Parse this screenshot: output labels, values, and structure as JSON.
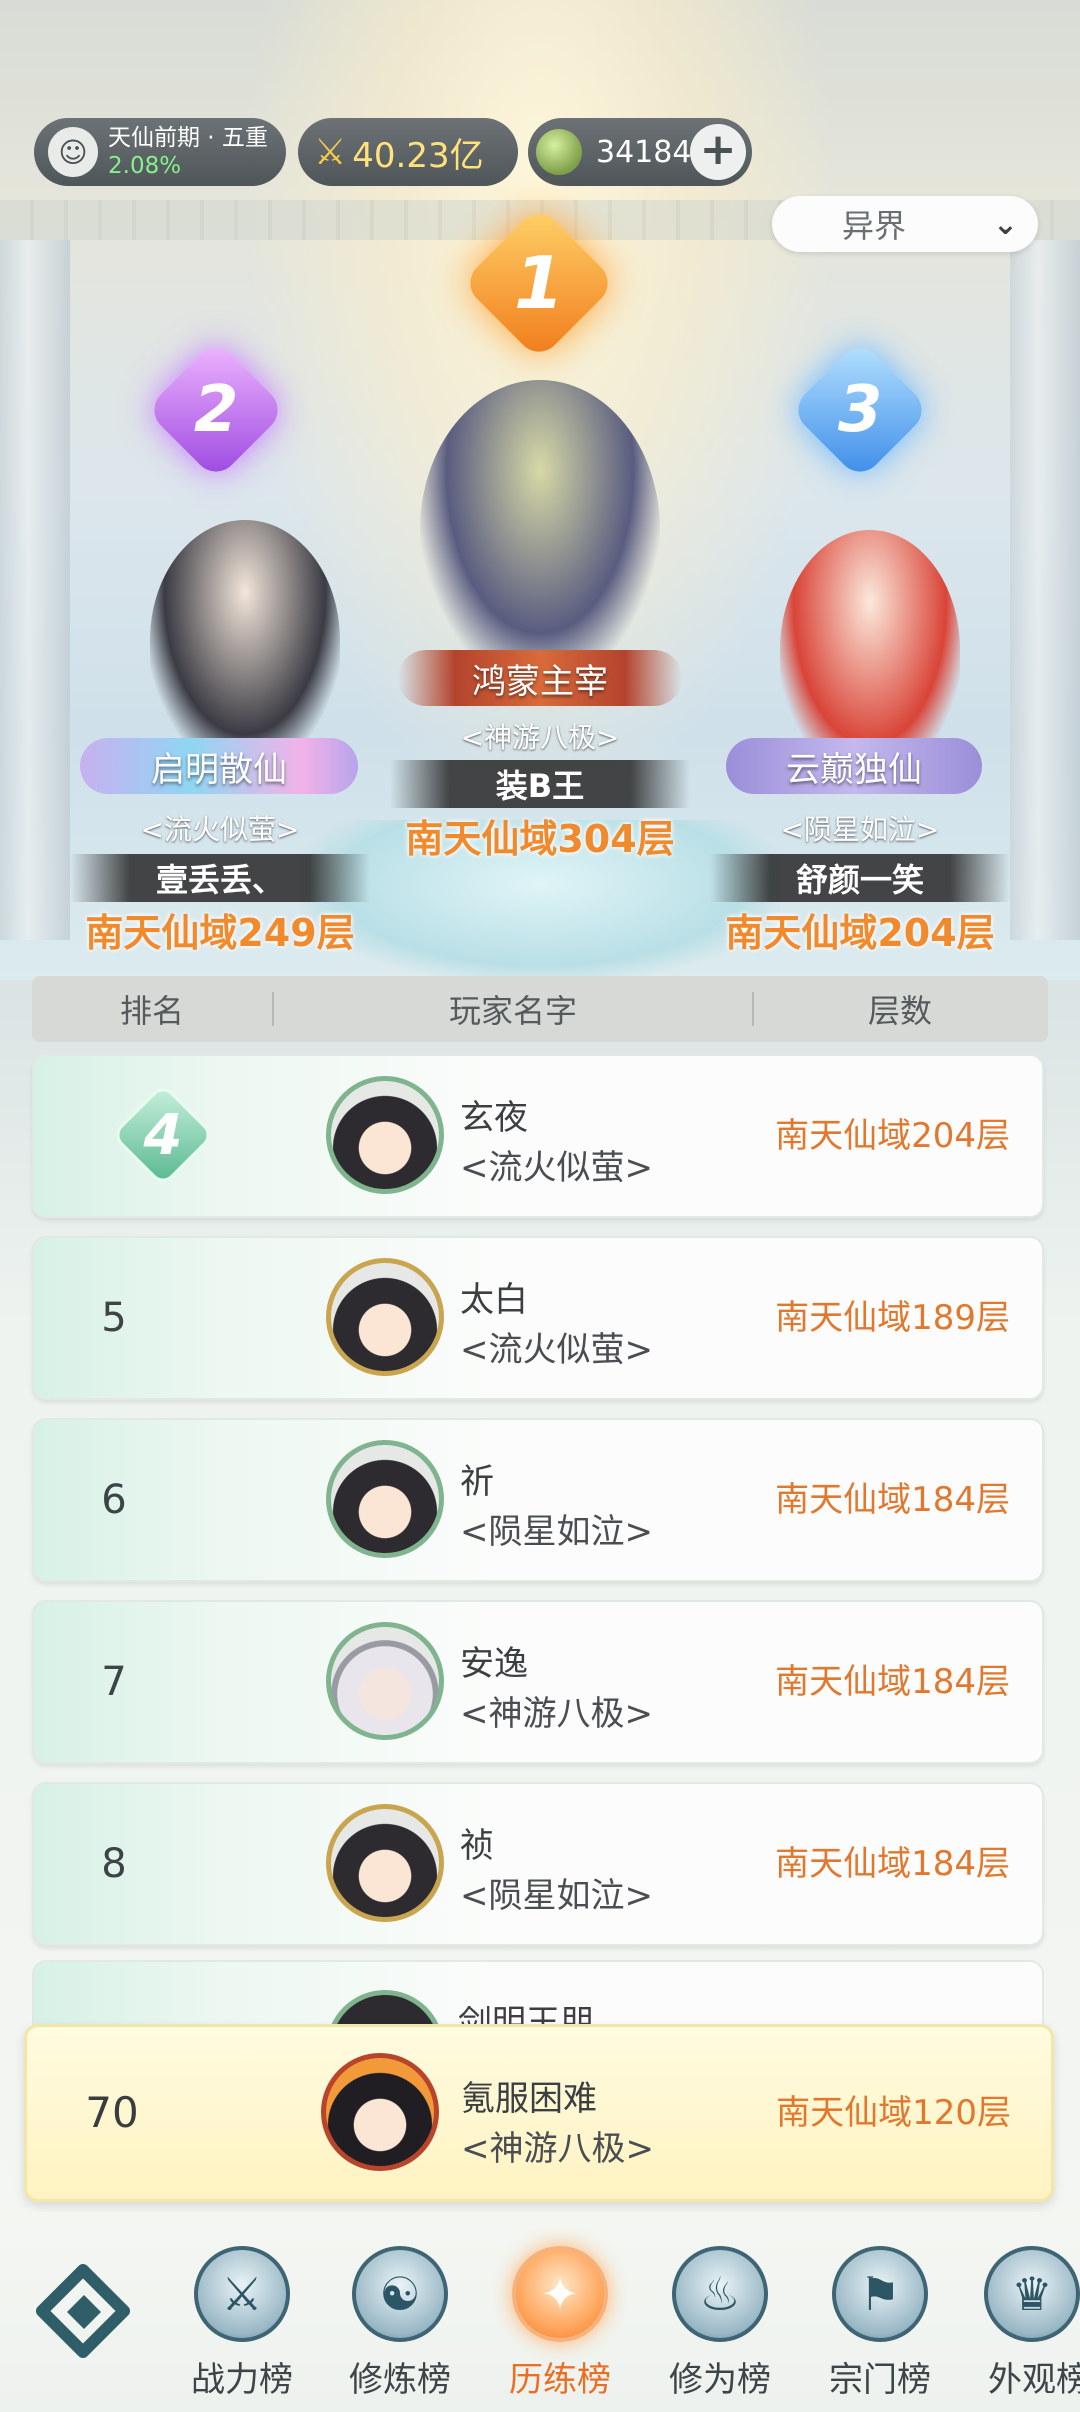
{
  "header": {
    "realm_name": "天仙前期 · 五重",
    "realm_progress": "2.08%",
    "combat_power": "40.23亿",
    "currency_amount": "34184",
    "add_icon": "plus-icon",
    "realm_filter": "异界",
    "filter_icon": "chevron-down-icon"
  },
  "podium": {
    "first": {
      "rank": "1",
      "title": "鸿蒙主宰",
      "sect": "<神游八极>",
      "player": "装B王",
      "floor": "南天仙域304层"
    },
    "second": {
      "rank": "2",
      "title": "启明散仙",
      "sect": "<流火似萤>",
      "player": "壹丢丢、",
      "floor": "南天仙域249层"
    },
    "third": {
      "rank": "3",
      "title": "云巅独仙",
      "sect": "<陨星如泣>",
      "player": "舒颜一笑",
      "floor": "南天仙域204层"
    }
  },
  "table": {
    "headers": {
      "rank": "排名",
      "player": "玩家名字",
      "floor": "层数"
    },
    "rows": [
      {
        "rank": "4",
        "name": "玄夜",
        "sect": "<流火似萤>",
        "floor": "南天仙域204层"
      },
      {
        "rank": "5",
        "name": "太白",
        "sect": "<流火似萤>",
        "floor": "南天仙域189层"
      },
      {
        "rank": "6",
        "name": "祈",
        "sect": "<陨星如泣>",
        "floor": "南天仙域184层"
      },
      {
        "rank": "7",
        "name": "安逸",
        "sect": "<神游八极>",
        "floor": "南天仙域184层"
      },
      {
        "rank": "8",
        "name": "祯",
        "sect": "<陨星如泣>",
        "floor": "南天仙域184层"
      }
    ],
    "partial_row_name": "剑明王朋"
  },
  "my_rank": {
    "rank": "70",
    "name": "氪服困难",
    "sect": "<神游八极>",
    "floor": "南天仙域120层"
  },
  "nav": {
    "tabs": [
      {
        "label": "战力榜",
        "icon": "swords-icon"
      },
      {
        "label": "修炼榜",
        "icon": "yin-yang-icon"
      },
      {
        "label": "历练榜",
        "icon": "star-sparkle-icon"
      },
      {
        "label": "修为榜",
        "icon": "cultivator-icon"
      },
      {
        "label": "宗门榜",
        "icon": "sect-banner-icon"
      },
      {
        "label": "外观榜",
        "icon": "appearance-icon"
      }
    ],
    "active_tab": "历练榜",
    "accent_color": "#ea6f22"
  }
}
